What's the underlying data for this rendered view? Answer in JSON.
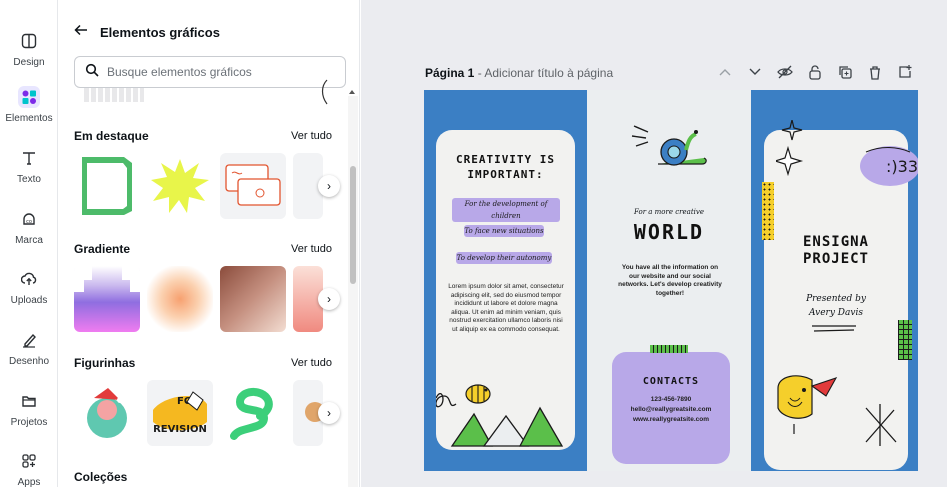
{
  "rail": {
    "items": [
      {
        "label": "Design",
        "icon": "layout-icon"
      },
      {
        "label": "Elementos",
        "icon": "elements-icon"
      },
      {
        "label": "Texto",
        "icon": "text-icon"
      },
      {
        "label": "Marca",
        "icon": "brand-icon"
      },
      {
        "label": "Uploads",
        "icon": "upload-icon"
      },
      {
        "label": "Desenho",
        "icon": "draw-icon"
      },
      {
        "label": "Projetos",
        "icon": "folder-icon"
      },
      {
        "label": "Apps",
        "icon": "apps-icon"
      }
    ],
    "active_color": "#e8e6ff"
  },
  "panel": {
    "title": "Elementos gráficos",
    "search_placeholder": "Busque elementos gráficos",
    "sections": [
      {
        "title": "Em destaque",
        "see_all": "Ver tudo"
      },
      {
        "title": "Gradiente",
        "see_all": "Ver tudo"
      },
      {
        "title": "Figurinhas",
        "see_all": "Ver tudo"
      },
      {
        "title": "Coleções",
        "see_all": ""
      }
    ],
    "sticker_text": [
      "FOR",
      "REVISION"
    ]
  },
  "editor": {
    "page_label": "Página 1",
    "page_title_placeholder": " - Adicionar título à página"
  },
  "brochure": {
    "left": {
      "heading": [
        "CREATIVITY IS",
        "IMPORTANT:"
      ],
      "pills": [
        "For the development of children",
        "To face new situations",
        "To develop their autonomy"
      ],
      "body": "Lorem ipsum dolor sit amet, consectetur adipiscing elit, sed do eiusmod tempor incididunt ut labore et dolore magna aliqua. Ut enim ad minim veniam, quis nostrud exercitation ullamco laboris nisi ut aliquip ex ea commodo consequat."
    },
    "middle": {
      "tagline": "For a more creative",
      "heading": "WORLD",
      "body": "You have all the information on our website and our social networks. Let's develop creativity together!",
      "contacts_title": "CONTACTS",
      "phone": "123-456-7890",
      "email": "hello@reallygreatsite.com",
      "site": "www.reallygreatsite.com"
    },
    "right": {
      "heading": [
        "ENSIGNA",
        "PROJECT"
      ],
      "presented": "Presented by",
      "author": "Avery Davis"
    },
    "colors": {
      "blue": "#3b7fc4",
      "purple": "#b8a8e8",
      "yellow": "#f5cf2b",
      "green": "#5bbf4a"
    }
  }
}
